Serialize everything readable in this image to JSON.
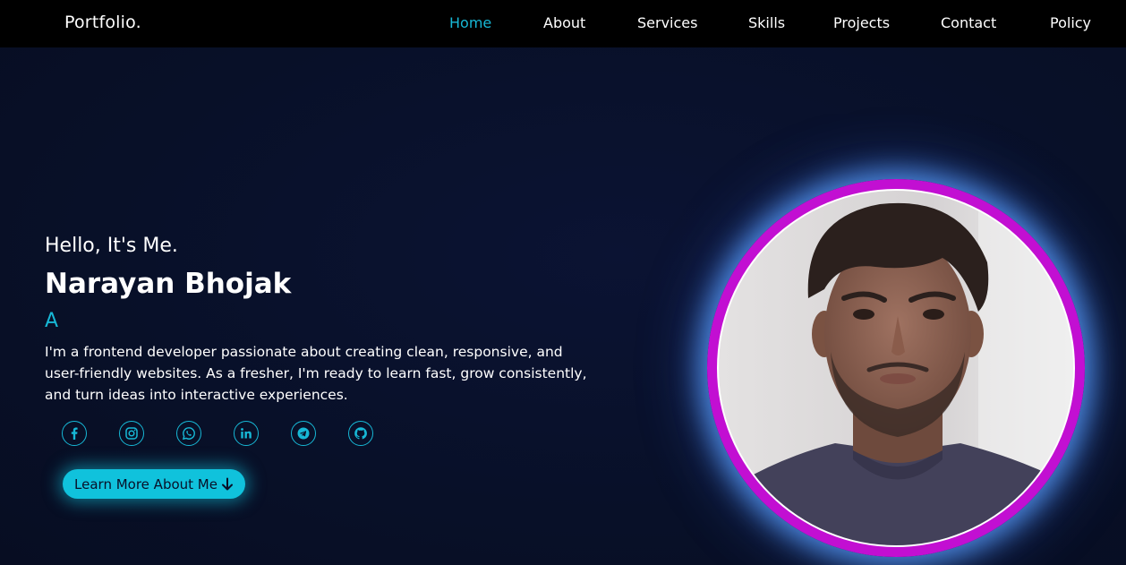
{
  "nav": {
    "logo": "Portfolio.",
    "links": [
      "Home",
      "About",
      "Services",
      "Skills",
      "Projects",
      "Contact",
      "Policy"
    ],
    "active": "Home"
  },
  "hero": {
    "greeting": "Hello, It's Me.",
    "name": "Narayan Bhojak",
    "typed_text": "A",
    "bio": "I'm a frontend developer passionate about creating clean, responsive, and user-friendly websites. As a fresher, I'm ready to learn fast, grow consistently, and turn ideas into interactive experiences.",
    "social_icons": [
      "facebook-icon",
      "instagram-icon",
      "whatsapp-icon",
      "linkedin-icon",
      "telegram-icon",
      "github-icon"
    ],
    "cta_label": "Learn More About Me",
    "cta_icon": "arrow-down-icon"
  },
  "colors": {
    "accent": "#17b8d6",
    "button": "#10c2dc",
    "background": "#081028",
    "navbar": "#000000",
    "photo_ring": "#c20fd2",
    "glow": "#5aa0ff"
  }
}
